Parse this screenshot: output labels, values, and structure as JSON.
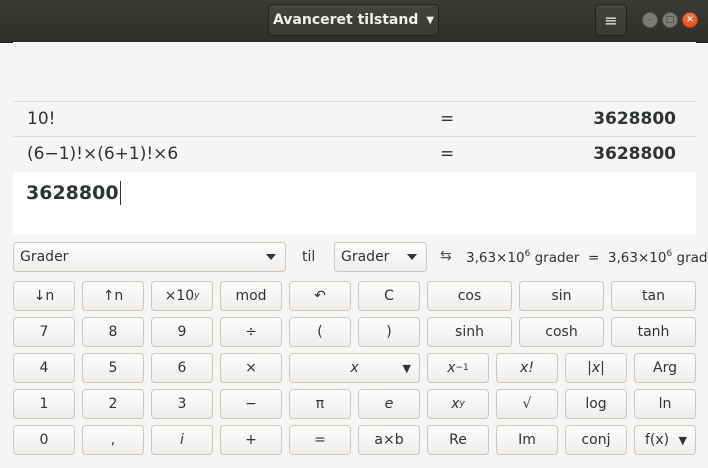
{
  "header": {
    "mode_label": "Avanceret tilstand",
    "menu_icon": "hamburger-menu-icon",
    "window_controls": [
      "minimize",
      "maximize",
      "close"
    ]
  },
  "history": [
    {
      "expression": "10!",
      "equals": "=",
      "result": "3628800"
    },
    {
      "expression": "(6−1)!×(6+1)!×6",
      "equals": "=",
      "result": "3628800"
    }
  ],
  "display": {
    "value": "3628800"
  },
  "conversion": {
    "from_unit": "Grader",
    "to_label": "til",
    "to_unit": "Grader",
    "swap_icon": "swap-arrows-icon",
    "result_left_mantissa": "3,63×10",
    "result_left_exp": "6",
    "result_left_unit": " grader",
    "result_equals": "=",
    "result_right_mantissa": "3,63×10",
    "result_right_exp": "6",
    "result_right_unit": " grader"
  },
  "keys": {
    "shift_right": "↓n",
    "shift_left": "↑n",
    "exponent_base": "×10",
    "exponent_sup": "y",
    "mod": "mod",
    "backspace": "↶",
    "clear": "C",
    "cos": "cos",
    "sin": "sin",
    "tan": "tan",
    "seven": "7",
    "eight": "8",
    "nine": "9",
    "divide": "÷",
    "open_paren": "(",
    "close_paren": ")",
    "sinh": "sinh",
    "cosh": "cosh",
    "tanh": "tanh",
    "four": "4",
    "five": "5",
    "six": "6",
    "multiply": "×",
    "variable": "x",
    "inverse_base": "x",
    "inverse_sup": "−1",
    "factorial": "x!",
    "abs": "|x|",
    "arg": "Arg",
    "one": "1",
    "two": "2",
    "three": "3",
    "minus": "−",
    "pi": "π",
    "euler": "e",
    "power_base": "x",
    "power_sup": "y",
    "sqrt": "√",
    "log": "log",
    "ln": "ln",
    "zero": "0",
    "decimal": ",",
    "imaginary": "i",
    "plus": "+",
    "equals": "=",
    "sci_notation": "a×b",
    "real": "Re",
    "imag": "Im",
    "conj": "conj",
    "function": "f(x)"
  }
}
